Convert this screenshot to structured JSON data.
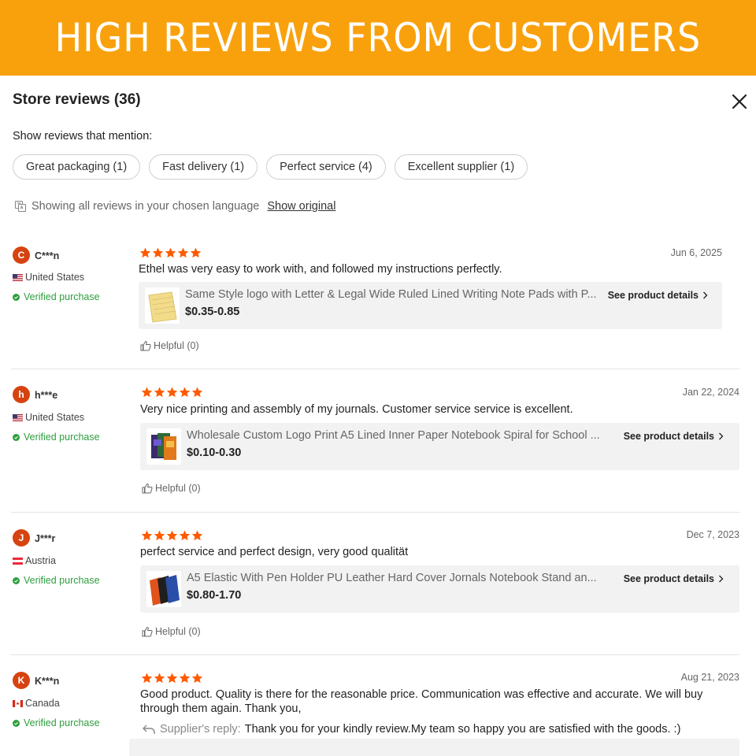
{
  "banner": {
    "title": "HIGH REVIEWS FROM CUSTOMERS",
    "color": "#f9a10d"
  },
  "modal": {
    "title": "Store reviews (36)",
    "filter_label": "Show reviews that mention:",
    "chips": [
      "Great packaging (1)",
      "Fast delivery (1)",
      "Perfect service (4)",
      "Excellent supplier (1)"
    ],
    "language_notice": "Showing all reviews in your chosen language",
    "show_original": "Show original"
  },
  "colors": {
    "star": "#ff5a00",
    "avatar": "#d64310",
    "verified": "#2e9e3e",
    "card_bg": "#f2f2f2"
  },
  "reviews": [
    {
      "initial": "C",
      "name": "C***n",
      "country": "United States",
      "flag": "us-flag-icon",
      "verified": "Verified purchase",
      "rating": 5,
      "date": "Jun 6, 2025",
      "comment": "Ethel was very easy to work with, and followed my instructions perfectly.",
      "product": {
        "name": "Same Style logo with Letter & Legal Wide Ruled Lined Writing Note Pads with P...",
        "price": "$0.35-0.85",
        "see_details": "See product details"
      },
      "helpful": "Helpful (0)"
    },
    {
      "initial": "h",
      "name": "h***e",
      "country": "United States",
      "flag": "us-flag-icon",
      "verified": "Verified purchase",
      "rating": 5,
      "date": "Jan 22, 2024",
      "comment": "Very nice printing and assembly of my journals. Customer service service is excellent.",
      "product": {
        "name": "Wholesale Custom Logo Print A5 Lined Inner Paper Notebook Spiral for School ...",
        "price": "$0.10-0.30",
        "see_details": "See product details"
      },
      "helpful": "Helpful (0)"
    },
    {
      "initial": "J",
      "name": "J***r",
      "country": "Austria",
      "flag": "austria-flag-icon",
      "verified": "Verified purchase",
      "rating": 5,
      "date": "Dec 7, 2023",
      "comment": "perfect service and perfect design, very good qualität",
      "product": {
        "name": "A5 Elastic With Pen Holder PU Leather Hard Cover Jornals Notebook Stand an...",
        "price": "$0.80-1.70",
        "see_details": "See product details"
      },
      "helpful": "Helpful (0)"
    },
    {
      "initial": "K",
      "name": "K***n",
      "country": "Canada",
      "flag": "canada-flag-icon",
      "verified": "Verified purchase",
      "rating": 5,
      "date": "Aug 21, 2023",
      "comment_line1": "Good product. Quality is there for the reasonable price. Communication was effective and accurate. We will buy",
      "comment_line2": "through them again. Thank you,",
      "reply_label": "Supplier's reply:",
      "reply_text": "Thank you for your kindly review.My team so happy you are satisfied with the goods. :)"
    }
  ]
}
